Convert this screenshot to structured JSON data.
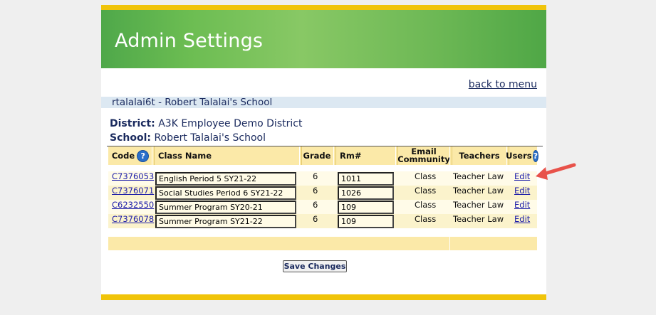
{
  "header": {
    "title": "Admin Settings"
  },
  "nav": {
    "back_label": "back to menu"
  },
  "school_bar": {
    "text": "rtalalai6t - Robert Talalai's School"
  },
  "info": {
    "district_label": "District:",
    "district_value": "A3K Employee Demo District",
    "school_label": "School:",
    "school_value": "Robert Talalai's School"
  },
  "table": {
    "headers": {
      "code": "Code",
      "class_name": "Class Name",
      "grade": "Grade",
      "room": "Rm#",
      "email_community": "Email Community",
      "teachers": "Teachers",
      "users": "Users"
    },
    "help_icon": "?",
    "rows": [
      {
        "code": "C7376053",
        "class_name": "English Period 5 SY21-22",
        "grade": "6",
        "room": "1011",
        "email": "Class",
        "teacher": "Teacher Law",
        "action": "Edit"
      },
      {
        "code": "C7376071",
        "class_name": "Social Studies Period 6 SY21-22",
        "grade": "6",
        "room": "1026",
        "email": "Class",
        "teacher": "Teacher Law",
        "action": "Edit"
      },
      {
        "code": "C6232550",
        "class_name": "Summer Program SY20-21",
        "grade": "6",
        "room": "109",
        "email": "Class",
        "teacher": "Teacher Law",
        "action": "Edit"
      },
      {
        "code": "C7376078",
        "class_name": "Summer Program SY21-22",
        "grade": "6",
        "room": "109",
        "email": "Class",
        "teacher": "Teacher Law",
        "action": "Edit"
      }
    ]
  },
  "actions": {
    "save_label": "Save Changes"
  },
  "annotation": {
    "arrow_color": "#e8524a",
    "icon": "arrow-pointing-left"
  },
  "colors": {
    "accent_yellow": "#f0c40a",
    "banner_green": "#6cbd52",
    "header_row": "#fbe9a8"
  }
}
